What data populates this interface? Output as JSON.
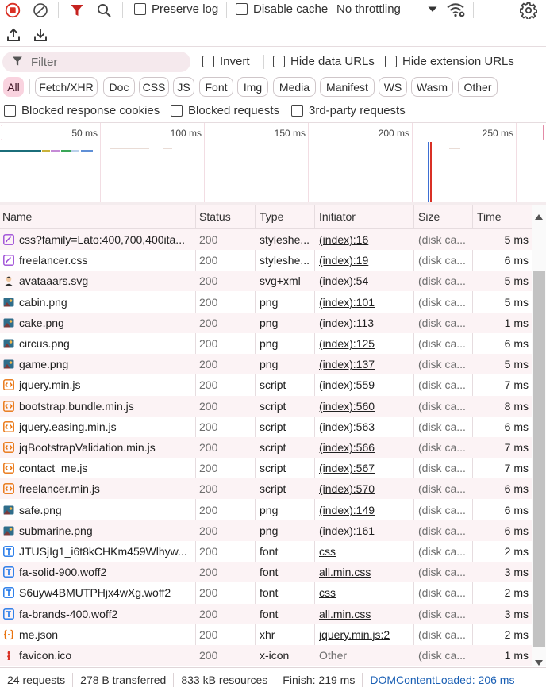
{
  "toolbar": {
    "preserve_log_label": "Preserve log",
    "disable_cache_label": "Disable cache",
    "throttling_value": "No throttling"
  },
  "filters": {
    "filter_placeholder": "Filter",
    "invert_label": "Invert",
    "hide_data_urls_label": "Hide data URLs",
    "hide_extension_urls_label": "Hide extension URLs",
    "type_chips": [
      "All",
      "Fetch/XHR",
      "Doc",
      "CSS",
      "JS",
      "Font",
      "Img",
      "Media",
      "Manifest",
      "WS",
      "Wasm",
      "Other"
    ],
    "blocked_cookies_label": "Blocked response cookies",
    "blocked_requests_label": "Blocked requests",
    "third_party_label": "3rd-party requests"
  },
  "overview": {
    "tick_labels": [
      "50 ms",
      "100 ms",
      "150 ms",
      "200 ms",
      "250 ms"
    ]
  },
  "table": {
    "columns": [
      "Name",
      "Status",
      "Type",
      "Initiator",
      "Size",
      "Time"
    ],
    "rows": [
      {
        "name": "css?family=Lato:400,700,400ita...",
        "status": "200",
        "type": "styleshe...",
        "initiator": "(index):16",
        "size": "(disk ca...",
        "time": "5 ms",
        "icon": "stylesheet-icon"
      },
      {
        "name": "freelancer.css",
        "status": "200",
        "type": "styleshe...",
        "initiator": "(index):19",
        "size": "(disk ca...",
        "time": "6 ms",
        "icon": "stylesheet-icon"
      },
      {
        "name": "avataaars.svg",
        "status": "200",
        "type": "svg+xml",
        "initiator": "(index):54",
        "size": "(disk ca...",
        "time": "5 ms",
        "icon": "avatar-image-icon"
      },
      {
        "name": "cabin.png",
        "status": "200",
        "type": "png",
        "initiator": "(index):101",
        "size": "(disk ca...",
        "time": "5 ms",
        "icon": "image-thumbnail-icon"
      },
      {
        "name": "cake.png",
        "status": "200",
        "type": "png",
        "initiator": "(index):113",
        "size": "(disk ca...",
        "time": "1 ms",
        "icon": "image-thumbnail-icon"
      },
      {
        "name": "circus.png",
        "status": "200",
        "type": "png",
        "initiator": "(index):125",
        "size": "(disk ca...",
        "time": "6 ms",
        "icon": "image-thumbnail-icon"
      },
      {
        "name": "game.png",
        "status": "200",
        "type": "png",
        "initiator": "(index):137",
        "size": "(disk ca...",
        "time": "5 ms",
        "icon": "image-thumbnail-icon"
      },
      {
        "name": "jquery.min.js",
        "status": "200",
        "type": "script",
        "initiator": "(index):559",
        "size": "(disk ca...",
        "time": "7 ms",
        "icon": "script-icon"
      },
      {
        "name": "bootstrap.bundle.min.js",
        "status": "200",
        "type": "script",
        "initiator": "(index):560",
        "size": "(disk ca...",
        "time": "8 ms",
        "icon": "script-icon"
      },
      {
        "name": "jquery.easing.min.js",
        "status": "200",
        "type": "script",
        "initiator": "(index):563",
        "size": "(disk ca...",
        "time": "6 ms",
        "icon": "script-icon"
      },
      {
        "name": "jqBootstrapValidation.min.js",
        "status": "200",
        "type": "script",
        "initiator": "(index):566",
        "size": "(disk ca...",
        "time": "7 ms",
        "icon": "script-icon"
      },
      {
        "name": "contact_me.js",
        "status": "200",
        "type": "script",
        "initiator": "(index):567",
        "size": "(disk ca...",
        "time": "7 ms",
        "icon": "script-icon"
      },
      {
        "name": "freelancer.min.js",
        "status": "200",
        "type": "script",
        "initiator": "(index):570",
        "size": "(disk ca...",
        "time": "6 ms",
        "icon": "script-icon"
      },
      {
        "name": "safe.png",
        "status": "200",
        "type": "png",
        "initiator": "(index):149",
        "size": "(disk ca...",
        "time": "6 ms",
        "icon": "image-thumbnail-icon"
      },
      {
        "name": "submarine.png",
        "status": "200",
        "type": "png",
        "initiator": "(index):161",
        "size": "(disk ca...",
        "time": "6 ms",
        "icon": "image-thumbnail-icon"
      },
      {
        "name": "JTUSjIg1_i6t8kCHKm459Wlhyw...",
        "status": "200",
        "type": "font",
        "initiator": "css",
        "size": "(disk ca...",
        "time": "2 ms",
        "icon": "font-icon"
      },
      {
        "name": "fa-solid-900.woff2",
        "status": "200",
        "type": "font",
        "initiator": "all.min.css",
        "size": "(disk ca...",
        "time": "3 ms",
        "icon": "font-icon"
      },
      {
        "name": "S6uyw4BMUTPHjx4wXg.woff2",
        "status": "200",
        "type": "font",
        "initiator": "css",
        "size": "(disk ca...",
        "time": "2 ms",
        "icon": "font-icon"
      },
      {
        "name": "fa-brands-400.woff2",
        "status": "200",
        "type": "font",
        "initiator": "all.min.css",
        "size": "(disk ca...",
        "time": "3 ms",
        "icon": "font-icon"
      },
      {
        "name": "me.json",
        "status": "200",
        "type": "xhr",
        "initiator": "jquery.min.js:2",
        "size": "(disk ca...",
        "time": "2 ms",
        "icon": "json-icon"
      },
      {
        "name": "favicon.ico",
        "status": "200",
        "type": "x-icon",
        "initiator": "Other",
        "size": "(disk ca...",
        "time": "1 ms",
        "icon": "favicon-icon"
      }
    ]
  },
  "statusbar": {
    "requests": "24 requests",
    "transferred": "278 B transferred",
    "resources": "833 kB resources",
    "finish": "Finish: 219 ms",
    "dom_content_loaded": "DOMContentLoaded: 206 ms"
  },
  "colors": {
    "accent_pink": "#f9d3df",
    "record_red": "#d93025",
    "filter_red": "#c5221f",
    "link_blue": "#1a5fb4"
  }
}
